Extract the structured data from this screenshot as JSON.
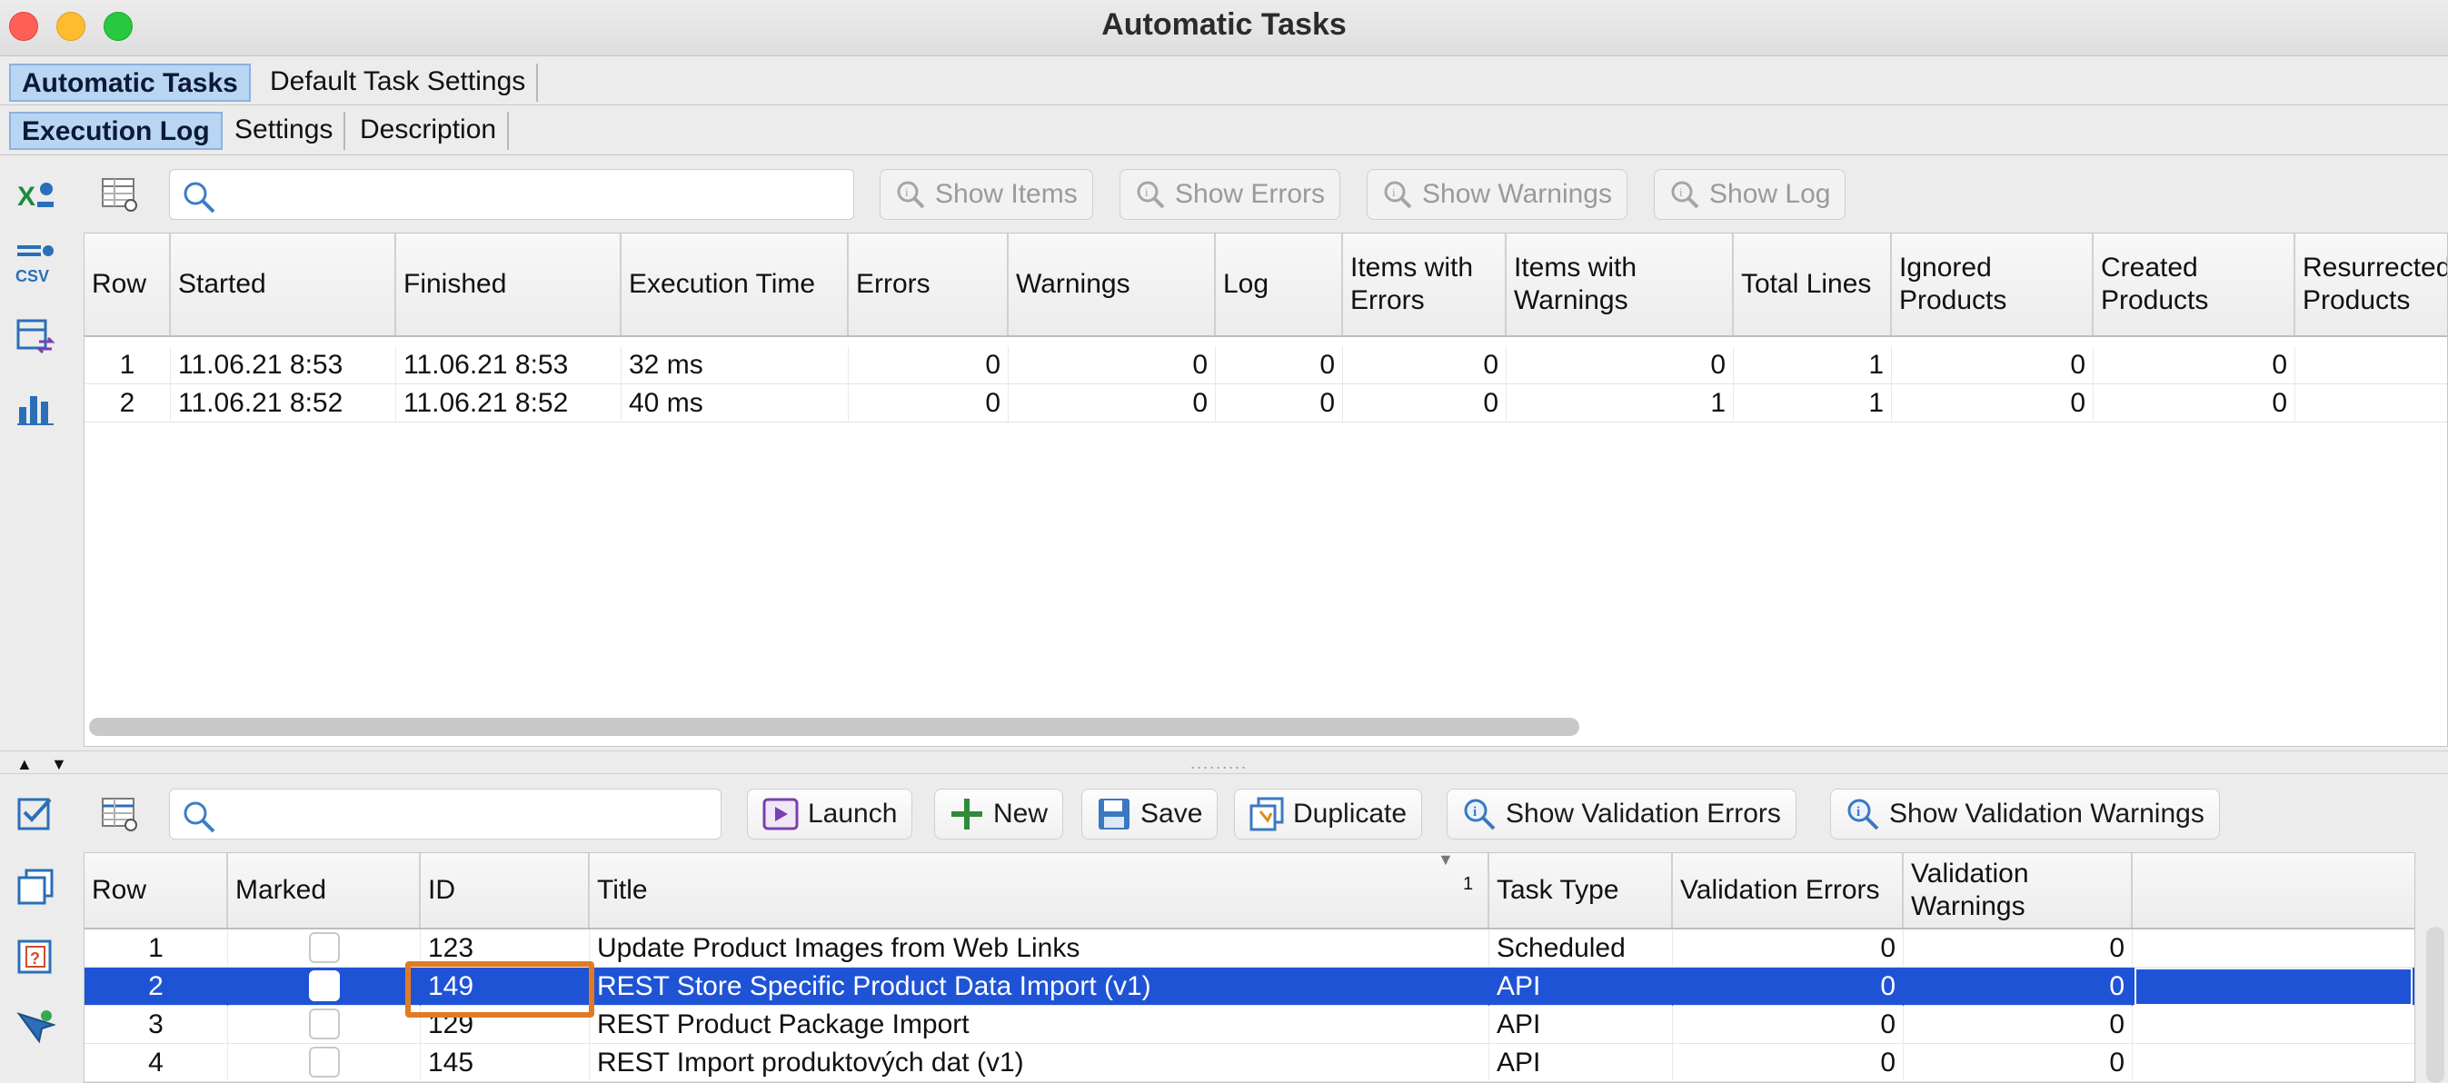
{
  "window": {
    "title": "Automatic Tasks"
  },
  "tabs_top": [
    "Automatic Tasks",
    "Default Task Settings"
  ],
  "tabs_sub": [
    "Execution Log",
    "Settings",
    "Description"
  ],
  "log_toolbar": {
    "search_placeholder": "",
    "show_items": "Show Items",
    "show_errors": "Show Errors",
    "show_warnings": "Show Warnings",
    "show_log": "Show Log"
  },
  "log_table": {
    "columns": [
      "Row",
      "Started",
      "Finished",
      "Execution Time",
      "Errors",
      "Warnings",
      "Log",
      "Items with\nErrors",
      "Items with\nWarnings",
      "Total Lines",
      "Ignored\nProducts",
      "Created\nProducts",
      "Resurrected\nProducts"
    ],
    "rows": [
      [
        "1",
        "11.06.21 8:53",
        "11.06.21 8:53",
        "32 ms",
        "0",
        "0",
        "0",
        "0",
        "0",
        "1",
        "0",
        "0",
        ""
      ],
      [
        "2",
        "11.06.21 8:52",
        "11.06.21 8:52",
        "40 ms",
        "0",
        "0",
        "0",
        "0",
        "1",
        "1",
        "0",
        "0",
        ""
      ]
    ]
  },
  "task_toolbar": {
    "search_placeholder": "",
    "launch": "Launch",
    "new": "New",
    "save": "Save",
    "duplicate": "Duplicate",
    "show_validation_errors": "Show Validation Errors",
    "show_validation_warnings": "Show Validation Warnings"
  },
  "task_table": {
    "sort_indicator": "1",
    "columns": [
      "Row",
      "Marked",
      "ID",
      "Title",
      "Task Type",
      "Validation Errors",
      "Validation\nWarnings",
      ""
    ],
    "rows": [
      [
        "1",
        "",
        "123",
        "Update Product Images from Web Links",
        "Scheduled",
        "0",
        "0"
      ],
      [
        "2",
        "",
        "149",
        "REST Store Specific Product Data Import (v1)",
        "API",
        "0",
        "0"
      ],
      [
        "3",
        "",
        "129",
        "REST Product Package Import",
        "API",
        "0",
        "0"
      ],
      [
        "4",
        "",
        "145",
        "REST Import produktových dat (v1)",
        "API",
        "0",
        "0"
      ]
    ],
    "selected_row": 2
  },
  "colors": {
    "selection": "#1f53d6",
    "highlight": "#e07b24",
    "active_tab": "#b9d5f4"
  }
}
